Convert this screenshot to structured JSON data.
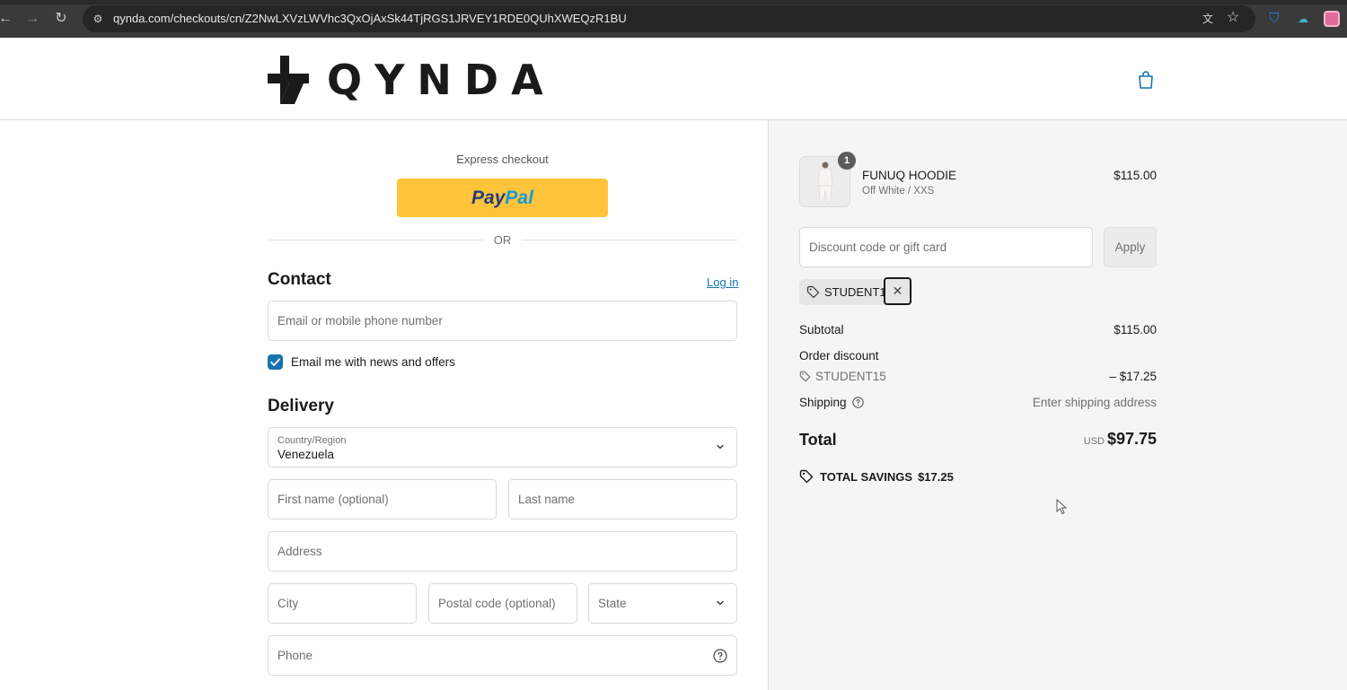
{
  "browser": {
    "url": "qynda.com/checkouts/cn/Z2NwLXVzLWVhc3QxOjAxSk44TjRGS1JRVEY1RDE0QUhXWEQzR1BU"
  },
  "store": {
    "name": "QYNDA"
  },
  "express": {
    "label": "Express checkout",
    "paypal_part1": "Pay",
    "paypal_part2": "Pal",
    "or_label": "OR"
  },
  "contact": {
    "title": "Contact",
    "login_label": "Log in",
    "email_placeholder": "Email or mobile phone number",
    "newsletter_label": "Email me with news and offers",
    "newsletter_checked": true
  },
  "delivery": {
    "title": "Delivery",
    "country_label": "Country/Region",
    "country_value": "Venezuela",
    "first_name_placeholder": "First name (optional)",
    "last_name_placeholder": "Last name",
    "address_placeholder": "Address",
    "city_placeholder": "City",
    "postal_placeholder": "Postal code (optional)",
    "state_placeholder": "State",
    "phone_placeholder": "Phone"
  },
  "order": {
    "item": {
      "name": "FUNUQ HOODIE",
      "variant": "Off White / XXS",
      "price": "$115.00",
      "quantity": "1"
    },
    "discount_placeholder": "Discount code or gift card",
    "apply_label": "Apply",
    "applied_code": "STUDENT15",
    "subtotal_label": "Subtotal",
    "subtotal_value": "$115.00",
    "order_discount_label": "Order discount",
    "discount_code": "STUDENT15",
    "discount_value": "– $17.25",
    "shipping_label": "Shipping",
    "shipping_value": "Enter shipping address",
    "total_label": "Total",
    "currency": "USD",
    "total_value": "$97.75",
    "savings_label": "TOTAL SAVINGS",
    "savings_value": "$17.25"
  },
  "colors": {
    "accent": "#1773b0",
    "paypal_yellow": "#ffc439",
    "summary_bg": "#f5f5f5"
  }
}
